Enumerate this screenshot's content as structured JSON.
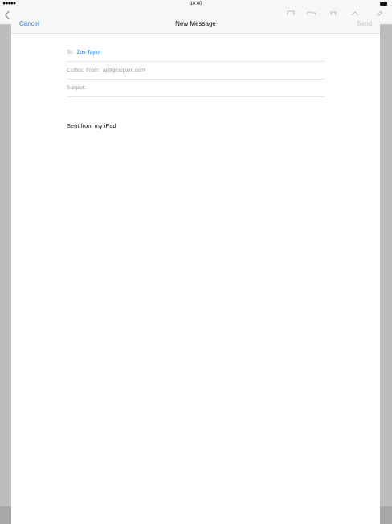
{
  "status_bar": {
    "signal": "●●●●●",
    "time": "10:00"
  },
  "background_app": {
    "toolbar_icons": [
      "flag-icon",
      "folder-icon",
      "trash-icon",
      "reply-icon",
      "compose-icon"
    ]
  },
  "compose": {
    "cancel_label": "Cancel",
    "title": "New Message",
    "send_label": "Send",
    "to_label": "To:",
    "to_recipient": "Zoe Taylor",
    "ccbcc_label": "Cc/Bcc, From:",
    "from_value": "aj@groupwm.com",
    "subject_label": "Subject:",
    "body": "Sent from my iPad"
  },
  "colors": {
    "accent": "#1a7cf5",
    "disabled": "#c3c3c3",
    "label": "#9a9a9a"
  }
}
